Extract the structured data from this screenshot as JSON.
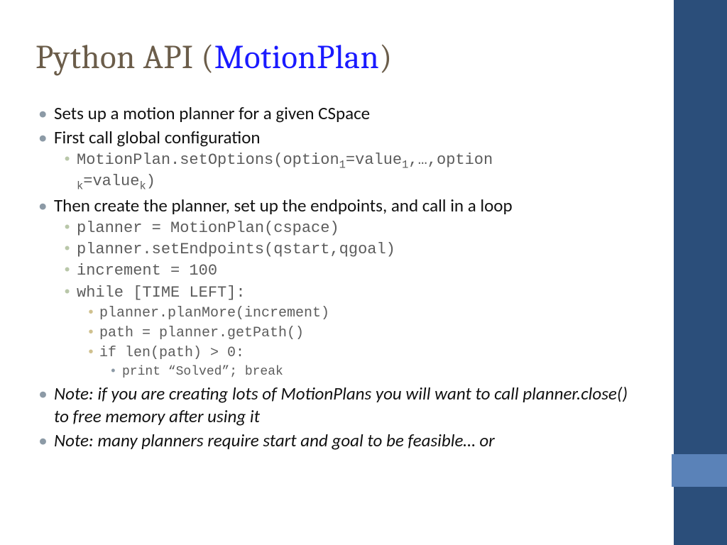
{
  "title": {
    "prefix": "Python API (",
    "link": "MotionPlan",
    "suffix": ")"
  },
  "bullets": {
    "b1": "Sets up a motion planner for a given CSpace",
    "b2": "First call global configuration",
    "b2_code_a": "MotionPlan.setOptions(option",
    "b2_code_b": "=value",
    "b2_code_c": ",…,option",
    "b2_code_d": "=value",
    "b2_code_e": ")",
    "sub1": "1",
    "subk": "k",
    "b3": "Then create the planner, set up the endpoints, and call in a loop",
    "c1": "planner = MotionPlan(cspace)",
    "c2": "planner.setEndpoints(qstart,qgoal)",
    "c3": "increment = 100",
    "c4": "while [TIME LEFT]:",
    "c4a": "planner.planMore(increment)",
    "c4b": "path = planner.getPath()",
    "c4c": "if len(path) > 0:",
    "c4c1": "print “Solved”; break",
    "n1": "Note: if you are creating lots of MotionPlans you will want to call planner.close() to free memory after using it",
    "n2": "Note: many planners require start and goal to be feasible… or"
  }
}
